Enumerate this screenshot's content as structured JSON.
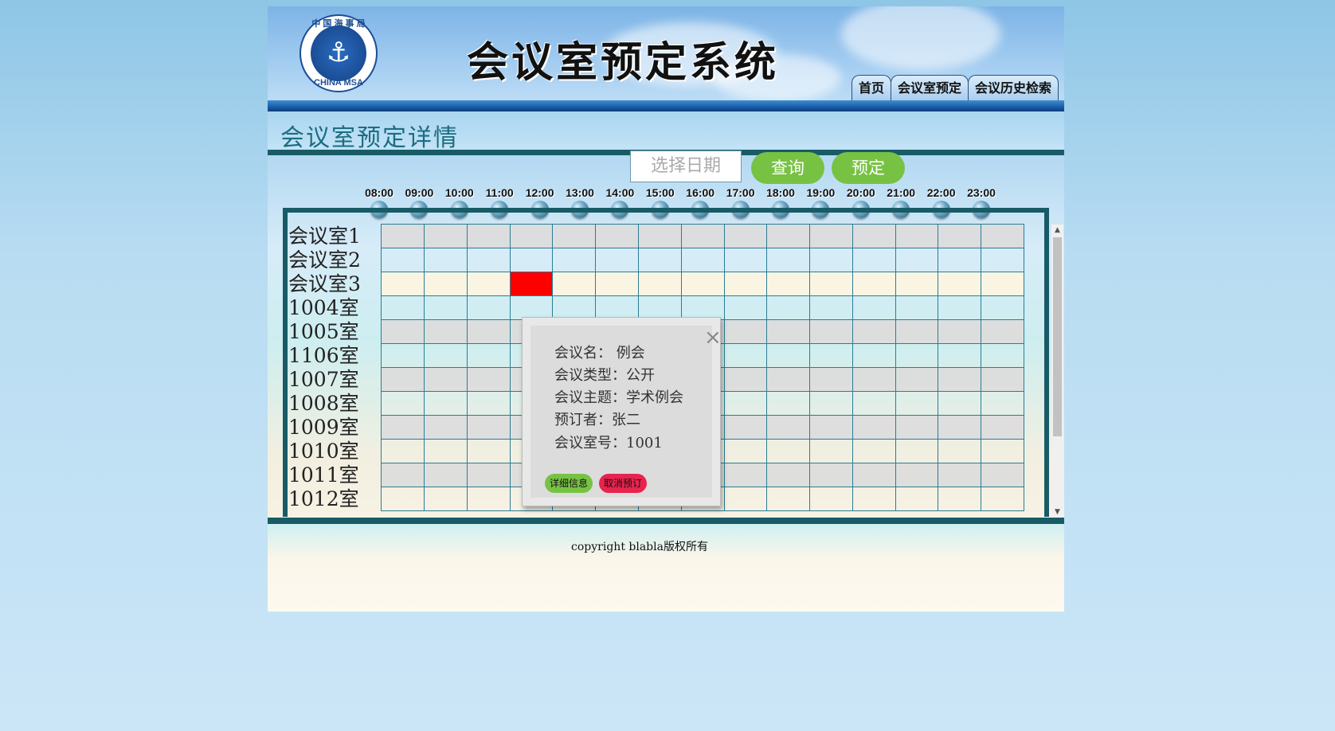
{
  "header": {
    "logo_top": "中 国 海 事 局",
    "logo_bottom": "CHINA MSA",
    "title": "会议室预定系统"
  },
  "nav": [
    "首页",
    "会议室预定",
    "会议历史检索"
  ],
  "page_title": "会议室预定详情",
  "controls": {
    "date_placeholder": "选择日期",
    "query_label": "查询",
    "book_label": "预定"
  },
  "times": [
    "08:00",
    "09:00",
    "10:00",
    "11:00",
    "12:00",
    "13:00",
    "14:00",
    "15:00",
    "16:00",
    "17:00",
    "18:00",
    "19:00",
    "20:00",
    "21:00",
    "22:00",
    "23:00"
  ],
  "rooms": [
    "会议室1",
    "会议室2",
    "会议室3",
    "1004室",
    "1005室",
    "1106室",
    "1007室",
    "1008室",
    "1009室",
    "1010室",
    "1011室",
    "1012室"
  ],
  "booked_slot": {
    "room": "会议室3",
    "time": "11:00",
    "color": "#ff0000"
  },
  "popup": {
    "name_line": "会议名：  例会",
    "type_line": "会议类型：公开",
    "topic_line": "会议主题：学术例会",
    "booker_line": "预订者：张二",
    "room_line": "会议室号：1001",
    "details_label": "详细信息",
    "cancel_label": "取消预订",
    "details_color": "#77c243",
    "cancel_color": "#e8234e"
  },
  "footer": {
    "copyright": "copyright blabla版权所有"
  }
}
